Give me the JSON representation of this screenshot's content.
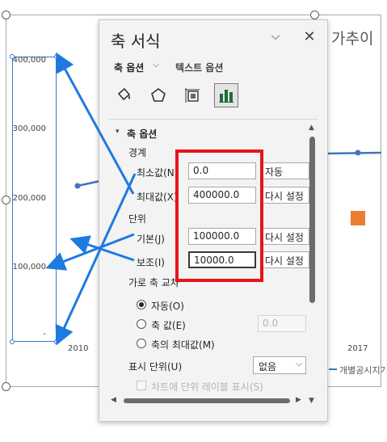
{
  "chart": {
    "title_fragment": "가추이",
    "y_ticks": [
      "400,000",
      "300,000",
      "200,000",
      "100,000",
      "-"
    ],
    "x_ticks": [
      "2010",
      "2017"
    ],
    "legend_label": "개별공시지가"
  },
  "pane": {
    "title": "축 서식",
    "collapse_icon": "chevron-down-icon",
    "close_icon": "close-icon",
    "tabs": {
      "axis_options": "축 옵션",
      "text_options": "텍스트 옵션"
    },
    "icon_tabs": [
      "fill-line-icon",
      "effects-pentagon-icon",
      "size-properties-icon",
      "axis-options-bar-chart-icon"
    ],
    "section_title": "축 옵션",
    "bounds": {
      "group_label": "경계",
      "minimum": {
        "label": "최소값(N)",
        "value": "0.0",
        "button": "자동"
      },
      "maximum": {
        "label": "최대값(X)",
        "value": "400000.0",
        "button": "다시 설정"
      }
    },
    "units": {
      "group_label": "단위",
      "major": {
        "label": "기본(J)",
        "value": "100000.0",
        "button": "다시 설정"
      },
      "minor": {
        "label": "보조(I)",
        "value": "10000.0",
        "button": "다시 설정"
      }
    },
    "crosses": {
      "label": "가로 축 교차",
      "options": [
        {
          "label": "자동(O)",
          "checked": true
        },
        {
          "label": "축 값(E)",
          "checked": false
        },
        {
          "label": "축의 최대값(M)",
          "checked": false
        }
      ],
      "axis_value": "0.0"
    },
    "display_units": {
      "label": "표시 단위(U)",
      "value": "없음"
    },
    "show_units_label": {
      "label": "차트에 단위 레이블 표시(S)",
      "checked": false
    }
  },
  "colors": {
    "highlight": "#e8141a",
    "arrow": "#1f7ae0",
    "series_blue": "#4472c4",
    "series_orange": "#ed7d31"
  }
}
